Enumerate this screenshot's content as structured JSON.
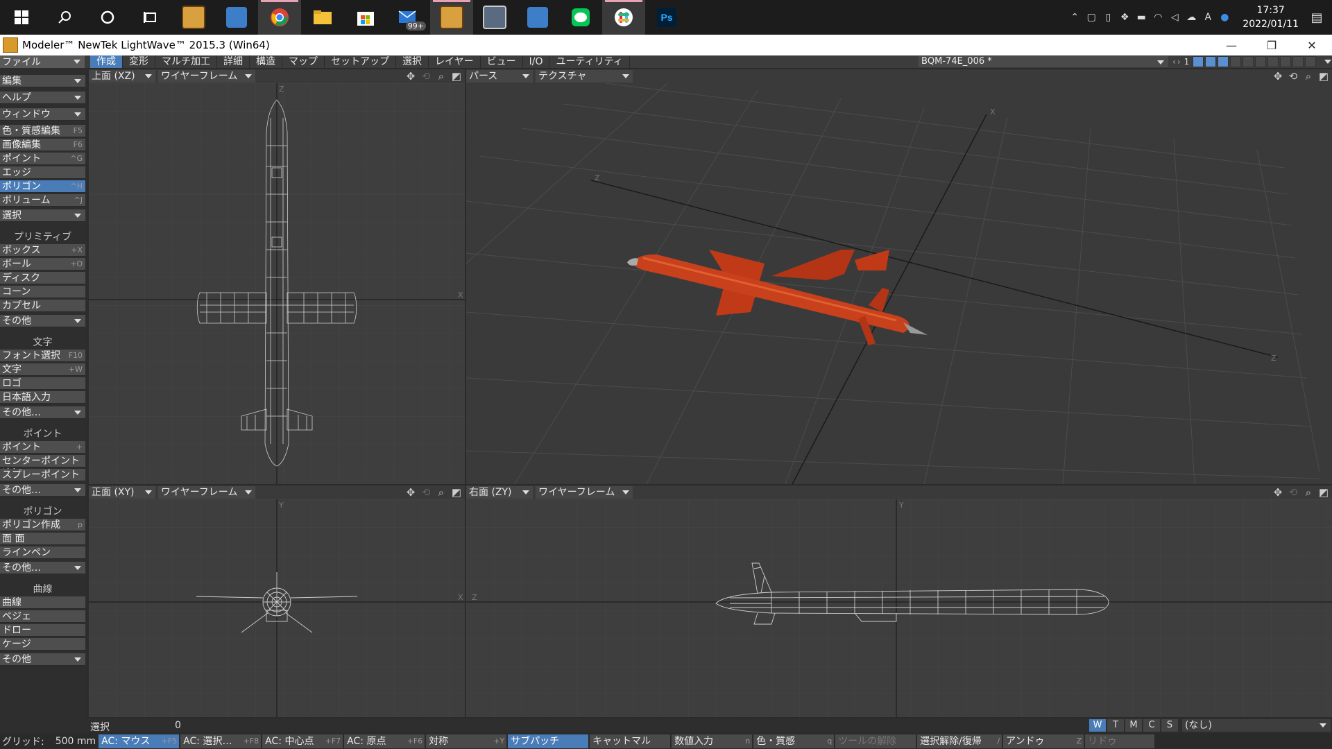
{
  "taskbar": {
    "apps": [
      {
        "name": "windows-start-icon",
        "active": false
      },
      {
        "name": "search-icon",
        "active": false
      },
      {
        "name": "cortana-icon",
        "active": false
      },
      {
        "name": "task-view-icon",
        "active": false
      },
      {
        "name": "lightwave-layout-icon",
        "active": false
      },
      {
        "name": "camera-app-icon",
        "active": false
      },
      {
        "name": "chrome-icon",
        "active": true
      },
      {
        "name": "file-explorer-icon",
        "active": false
      },
      {
        "name": "microsoft-store-icon",
        "active": false
      },
      {
        "name": "mail-icon",
        "active": false,
        "badge": "99+"
      },
      {
        "name": "lightwave-modeler-icon",
        "active": true
      },
      {
        "name": "photos-app-icon",
        "active": false
      },
      {
        "name": "camera-app-icon-2",
        "active": false
      },
      {
        "name": "line-icon",
        "active": false
      },
      {
        "name": "slack-icon",
        "active": true
      },
      {
        "name": "photoshop-icon",
        "active": false
      }
    ],
    "clock_time": "17:37",
    "clock_date": "2022/01/11"
  },
  "window": {
    "title": "Modeler™ NewTek LightWave™ 2015.3 (Win64)"
  },
  "menu": {
    "file": "ファイル",
    "tabs": [
      "作成",
      "変形",
      "マルチ加工",
      "詳細",
      "構造",
      "マップ",
      "セットアップ",
      "選択",
      "レイヤー",
      "ビュー",
      "I/O",
      "ユーティリティ"
    ],
    "active_tab": 0,
    "object_name": "BQM-74E_006 *",
    "layer_num": "1"
  },
  "sidebar": {
    "items": [
      {
        "type": "dd",
        "label": "編集"
      },
      {
        "type": "dd",
        "label": "ヘルプ"
      },
      {
        "type": "dd",
        "label": "ウィンドウ"
      },
      {
        "type": "item",
        "label": "色・質感編集",
        "sc": "F5"
      },
      {
        "type": "item",
        "label": "画像編集",
        "sc": "F6"
      },
      {
        "type": "item",
        "label": "ポイント",
        "sc": "^G"
      },
      {
        "type": "item",
        "label": "エッジ",
        "sc": ""
      },
      {
        "type": "item",
        "label": "ポリゴン",
        "sc": "^H",
        "selected": true
      },
      {
        "type": "item",
        "label": "ボリューム",
        "sc": "^J"
      },
      {
        "type": "dd",
        "label": "選択"
      },
      {
        "type": "head",
        "label": "プリミティブ"
      },
      {
        "type": "item",
        "label": "ボックス",
        "sc": "+X"
      },
      {
        "type": "item",
        "label": "ボール",
        "sc": "+O"
      },
      {
        "type": "item",
        "label": "ディスク",
        "sc": ""
      },
      {
        "type": "item",
        "label": "コーン",
        "sc": ""
      },
      {
        "type": "item",
        "label": "カプセル",
        "sc": ""
      },
      {
        "type": "dd",
        "label": "その他"
      },
      {
        "type": "head",
        "label": "文字"
      },
      {
        "type": "item",
        "label": "フォント選択",
        "sc": "F10"
      },
      {
        "type": "item",
        "label": "文字",
        "sc": "+W"
      },
      {
        "type": "item",
        "label": "ロゴ",
        "sc": ""
      },
      {
        "type": "item",
        "label": "日本語入力",
        "sc": ""
      },
      {
        "type": "dd",
        "label": "その他…"
      },
      {
        "type": "head",
        "label": "ポイント"
      },
      {
        "type": "item",
        "label": "ポイント",
        "sc": "+"
      },
      {
        "type": "item",
        "label": "センターポイント追加",
        "sc": ""
      },
      {
        "type": "item",
        "label": "スプレーポイント",
        "sc": ""
      },
      {
        "type": "dd",
        "label": "その他…"
      },
      {
        "type": "head",
        "label": "ポリゴン"
      },
      {
        "type": "item",
        "label": "ポリゴン作成",
        "sc": "p"
      },
      {
        "type": "item",
        "label": "面 面",
        "sc": ""
      },
      {
        "type": "item",
        "label": "ラインペン",
        "sc": ""
      },
      {
        "type": "dd",
        "label": "その他…"
      },
      {
        "type": "head",
        "label": "曲線"
      },
      {
        "type": "item",
        "label": "曲線",
        "sc": ""
      },
      {
        "type": "item",
        "label": "ベジェ",
        "sc": ""
      },
      {
        "type": "item",
        "label": "ドロー",
        "sc": ""
      },
      {
        "type": "item",
        "label": "ケージ",
        "sc": ""
      },
      {
        "type": "dd",
        "label": "その他"
      }
    ]
  },
  "viewports": {
    "top": {
      "view": "上面  (XZ)",
      "mode": "ワイヤーフレーム",
      "axis_h": "X",
      "axis_v": "Z"
    },
    "persp": {
      "view": "パース",
      "mode": "テクスチャ",
      "axis_x": "X",
      "axis_z": "Z"
    },
    "front": {
      "view": "正面  (XY)",
      "mode": "ワイヤーフレーム",
      "axis_h": "X",
      "axis_v": "Y"
    },
    "right": {
      "view": "右面  (ZY)",
      "mode": "ワイヤーフレーム",
      "axis_h": "Z",
      "axis_v": "Y"
    }
  },
  "info": {
    "select_label": "選択",
    "select_count": "0",
    "surface_value": "(なし)",
    "modes": [
      "W",
      "T",
      "M",
      "C",
      "S"
    ],
    "active_mode": 0
  },
  "status": {
    "grid_label": "グリッド:",
    "grid_value": "500 mm",
    "buttons": [
      {
        "label": "AC: マウス",
        "sc": "+F5",
        "state": "active"
      },
      {
        "label": "AC: 選択…",
        "sc": "+F8",
        "state": ""
      },
      {
        "label": "AC: 中心点",
        "sc": "+F7",
        "state": ""
      },
      {
        "label": "AC: 原点",
        "sc": "+F6",
        "state": ""
      },
      {
        "label": "対称",
        "sc": "+Y",
        "state": ""
      },
      {
        "label": "サブパッチ",
        "sc": "",
        "state": "active"
      },
      {
        "label": "キャットマル",
        "sc": "",
        "state": ""
      },
      {
        "label": "数値入力",
        "sc": "n",
        "state": ""
      },
      {
        "label": "色・質感",
        "sc": "q",
        "state": ""
      },
      {
        "label": "ツールの解除",
        "sc": "",
        "state": "disabled"
      },
      {
        "label": "選択解除/復帰",
        "sc": "/",
        "state": ""
      },
      {
        "label": "アンドゥ",
        "sc": "Z",
        "state": ""
      },
      {
        "label": "リドゥ",
        "sc": "",
        "state": "disabled"
      }
    ]
  },
  "colors": {
    "accent": "#4a7db8",
    "missile": "#c8401c",
    "viewport_bg": "#3e3e3e",
    "grid": "#4a4a4a"
  }
}
